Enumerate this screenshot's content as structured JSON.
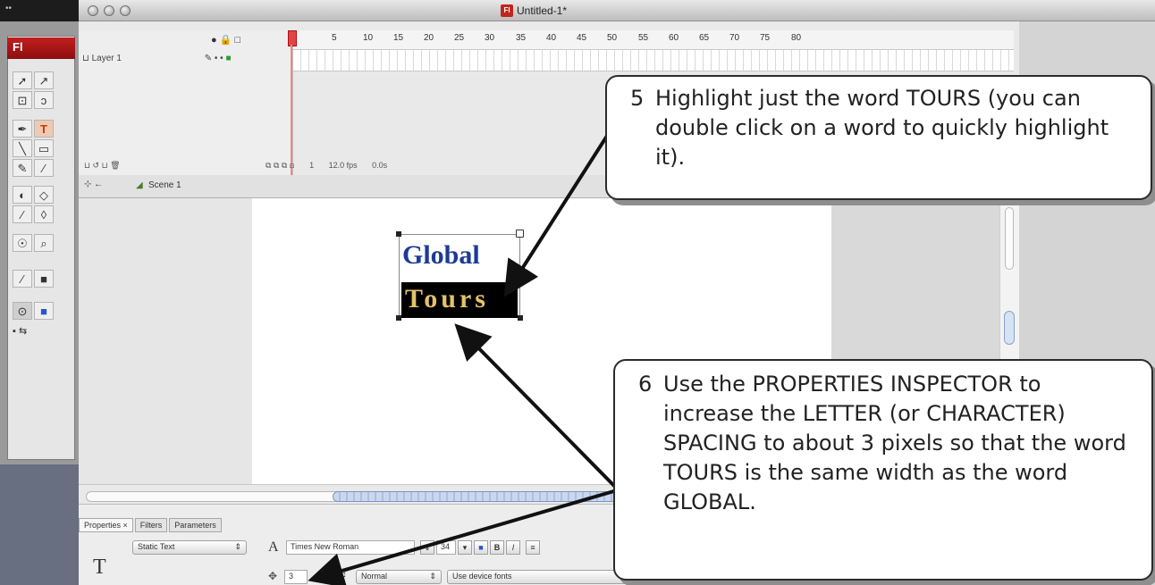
{
  "window": {
    "title": "Untitled-1*",
    "app_badge": "Fl",
    "doc_icon": "Fl"
  },
  "timeline": {
    "layer_name": "Layer 1",
    "frame_ticks": [
      "1",
      "5",
      "10",
      "15",
      "20",
      "25",
      "30",
      "35",
      "40",
      "45",
      "50",
      "55",
      "60",
      "65",
      "70",
      "75",
      "80"
    ],
    "frame": "1",
    "fps": "12.0 fps",
    "time": "0.0s"
  },
  "scene": {
    "label": "Scene 1"
  },
  "stage_text": {
    "line1": "Global",
    "line2": "Tours"
  },
  "properties": {
    "tabs": [
      "Properties ×",
      "Filters",
      "Parameters"
    ],
    "text_type": "Static Text",
    "font": "Times New Roman",
    "size": "34",
    "bold_label": "B",
    "italic_label": "I",
    "letter_spacing": "3",
    "position": "Normal",
    "rendering": "Use device fonts"
  },
  "callouts": {
    "step5": {
      "number": "5",
      "text": "Highlight just the word TOURS (you can double click on a word to quickly highlight it)."
    },
    "step6": {
      "number": "6",
      "text": "Use the PROPERTIES INSPECTOR to increase the LETTER (or CHARACTER) SPACING to about 3 pixels so that the word TOURS is the same width as the word GLOBAL."
    }
  },
  "colors": {
    "accent_red": "#c21f1f",
    "text_blue": "#1d3a96",
    "text_gold": "#e3c36a",
    "highlight_black": "#000000"
  }
}
